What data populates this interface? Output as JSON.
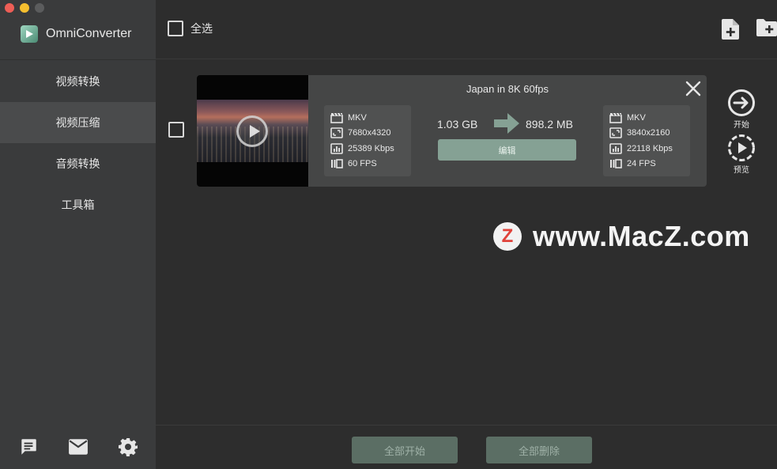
{
  "window": {
    "traffic_lights": [
      "close",
      "minimize",
      "zoom"
    ]
  },
  "app": {
    "name": "OmniConverter"
  },
  "sidebar": {
    "items": [
      {
        "label": "视频转换",
        "active": false
      },
      {
        "label": "视频压缩",
        "active": true
      },
      {
        "label": "音频转换",
        "active": false
      },
      {
        "label": "工具箱",
        "active": false
      }
    ],
    "bottom_icons": [
      "chat-icon",
      "mail-icon",
      "gear-icon"
    ]
  },
  "toolbar": {
    "select_all_label": "全选",
    "select_all_checked": false,
    "icons": [
      "add-file-icon",
      "add-folder-icon"
    ]
  },
  "item": {
    "checked": false,
    "title": "Japan in 8K 60fps",
    "source": {
      "format": "MKV",
      "resolution": "7680x4320",
      "bitrate": "25389 Kbps",
      "fps": "60 FPS"
    },
    "target": {
      "format": "MKV",
      "resolution": "3840x2160",
      "bitrate": "22118 Kbps",
      "fps": "24 FPS"
    },
    "size_in": "1.03 GB",
    "size_out": "898.2 MB",
    "edit_label": "编辑",
    "actions": {
      "start_label": "开始",
      "preview_label": "预览"
    }
  },
  "watermark": {
    "logo_letter": "Z",
    "text": "www.MacZ.com"
  },
  "bottombar": {
    "start_all_label": "全部开始",
    "delete_all_label": "全部删除"
  },
  "colors": {
    "accent": "#85a194",
    "sidebar_bg": "#3a3b3c",
    "main_bg": "#2d2d2d",
    "card_bg": "#454646"
  }
}
